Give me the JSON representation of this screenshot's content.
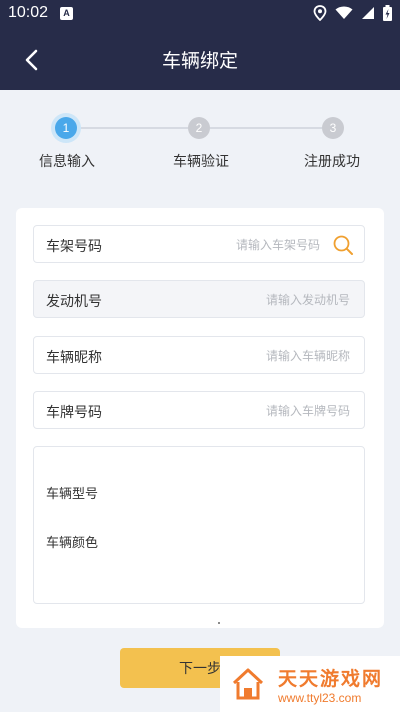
{
  "status_bar": {
    "time": "10:02",
    "notification_badge": "A",
    "icons": [
      "location-icon",
      "wifi-icon",
      "signal-icon",
      "battery-icon"
    ]
  },
  "header": {
    "title": "车辆绑定"
  },
  "stepper": {
    "steps": [
      {
        "number": "1",
        "label": "信息输入",
        "state": "active"
      },
      {
        "number": "2",
        "label": "车辆验证",
        "state": "inactive"
      },
      {
        "number": "3",
        "label": "注册成功",
        "state": "inactive"
      }
    ]
  },
  "form": {
    "fields": [
      {
        "label": "车架号码",
        "placeholder": "请输入车架号码",
        "value": ""
      },
      {
        "label": "发动机号",
        "placeholder": "请输入发动机号",
        "value": ""
      },
      {
        "label": "车辆昵称",
        "placeholder": "请输入车辆昵称",
        "value": ""
      },
      {
        "label": "车牌号码",
        "placeholder": "请输入车牌号码",
        "value": ""
      }
    ],
    "info": {
      "model_label": "车辆型号",
      "color_label": "车辆颜色"
    }
  },
  "actions": {
    "next_label": "下一步"
  },
  "watermark": {
    "name": "天天游戏网",
    "url": "www.ttyl23.com"
  },
  "colors": {
    "header_bg": "#272c49",
    "step_active": "#4aa8ea",
    "step_inactive": "#c9cbd1",
    "button_bg": "#f3c14f",
    "search_icon": "#f0a030",
    "watermark": "#f07b2e"
  }
}
